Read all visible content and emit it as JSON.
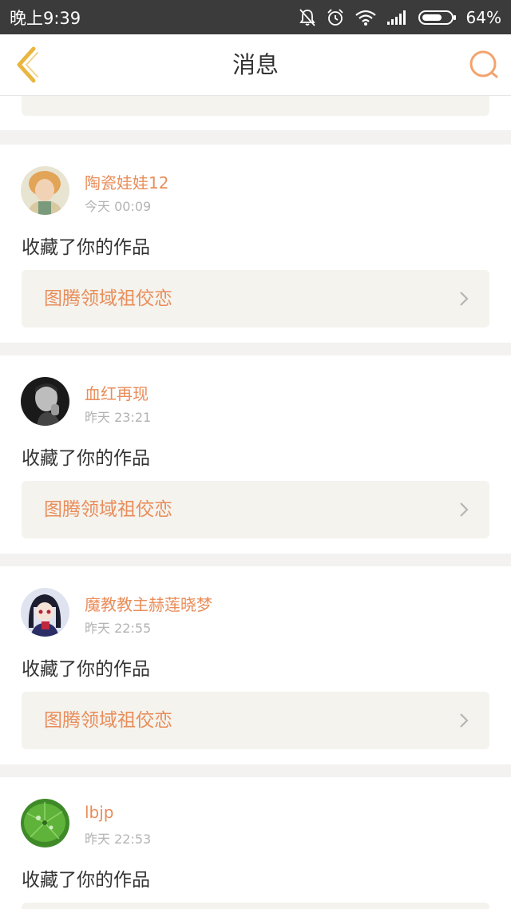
{
  "status_bar": {
    "time": "晚上9:39",
    "battery": "64%"
  },
  "nav": {
    "title": "消息"
  },
  "messages": [
    {
      "username": "陶瓷娃娃12",
      "time": "今天 00:09",
      "action": "收藏了你的作品",
      "work_title": "图腾领域祖佼恋",
      "avatar": "user-avatar-blonde"
    },
    {
      "username": "血红再现",
      "time": "昨天 23:21",
      "action": "收藏了你的作品",
      "work_title": "图腾领域祖佼恋",
      "avatar": "user-avatar-bw-portrait"
    },
    {
      "username": "魔教教主赫莲晓梦",
      "time": "昨天 22:55",
      "action": "收藏了你的作品",
      "work_title": "图腾领域祖佼恋",
      "avatar": "user-avatar-anime"
    },
    {
      "username": "lbjp",
      "time": "昨天 22:53",
      "action": "收藏了你的作品",
      "work_title": "",
      "avatar": "user-avatar-leaf"
    }
  ],
  "colors": {
    "accent": "#e98d5a",
    "back_icon": "#e9b640",
    "search_icon": "#f2a36e",
    "status_bar": "#3b3b3b",
    "link_bg": "#f4f3ee"
  }
}
